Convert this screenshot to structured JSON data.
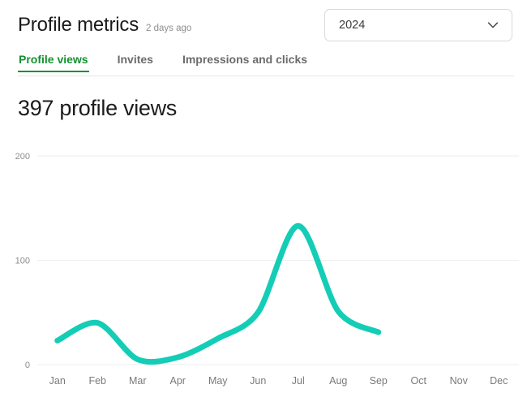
{
  "header": {
    "title": "Profile metrics",
    "subtitle": "2 days ago",
    "year_select": {
      "value": "2024",
      "icon": "chevron-down-icon"
    }
  },
  "tabs": [
    {
      "label": "Profile views",
      "active": true
    },
    {
      "label": "Invites",
      "active": false
    },
    {
      "label": "Impressions and clicks",
      "active": false
    }
  ],
  "main": {
    "metric_heading": "397 profile views"
  },
  "colors": {
    "line": "#14CDB6",
    "active_tab": "#12912f",
    "gridline": "#ededed",
    "tick_text": "#8d8d8d"
  },
  "chart_data": {
    "type": "line",
    "title": "397 profile views",
    "xlabel": "",
    "ylabel": "",
    "categories": [
      "Jan",
      "Feb",
      "Mar",
      "Apr",
      "May",
      "Jun",
      "Jul",
      "Aug",
      "Sep",
      "Oct",
      "Nov",
      "Dec"
    ],
    "series": [
      {
        "name": "Profile views",
        "color": "#14CDB6",
        "values": [
          23,
          40,
          5,
          7,
          25,
          50,
          133,
          51,
          31,
          null,
          null,
          null
        ]
      }
    ],
    "ylim": [
      0,
      200
    ],
    "yticks": [
      0,
      100,
      200
    ],
    "ytick_labels": [
      "0",
      "100",
      "200"
    ],
    "grid": true,
    "legend": "none"
  }
}
